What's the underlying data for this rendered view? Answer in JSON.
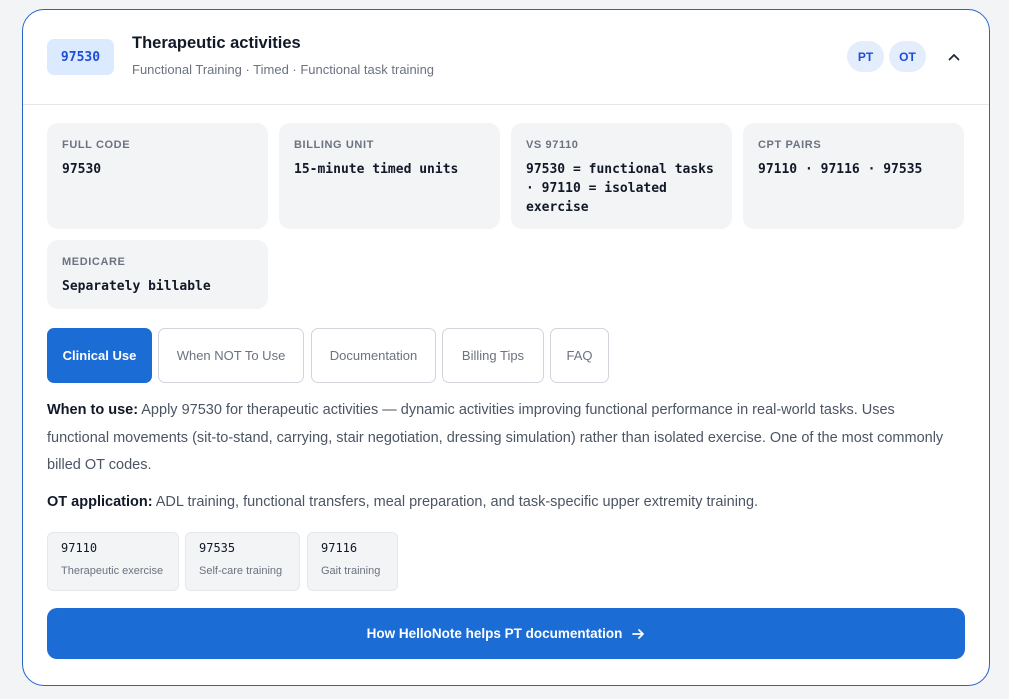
{
  "header": {
    "code": "97530",
    "title": "Therapeutic activities",
    "subtitle": "Functional Training · Timed · Functional task training",
    "disciplines": [
      "PT",
      "OT"
    ]
  },
  "info": [
    {
      "label": "FULL CODE",
      "value": "97530"
    },
    {
      "label": "BILLING UNIT",
      "value": "15-minute timed units"
    },
    {
      "label": "VS 97110",
      "value": "97530 = functional tasks · 97110 = isolated exercise"
    },
    {
      "label": "CPT PAIRS",
      "value": "97110 · 97116 · 97535"
    },
    {
      "label": "MEDICARE",
      "value": "Separately billable"
    }
  ],
  "tabs": [
    {
      "label": "Clinical Use",
      "active": true
    },
    {
      "label": "When NOT To Use",
      "active": false
    },
    {
      "label": "Documentation",
      "active": false
    },
    {
      "label": "Billing Tips",
      "active": false
    },
    {
      "label": "FAQ",
      "active": false
    }
  ],
  "content": {
    "when_label": "When to use:",
    "when_text": "Apply 97530 for therapeutic activities — dynamic activities improving functional performance in real-world tasks. Uses functional movements (sit-to-stand, carrying, stair negotiation, dressing simulation) rather than isolated exercise. One of the most commonly billed OT codes.",
    "ot_label": "OT application:",
    "ot_text": "ADL training, functional transfers, meal preparation, and task-specific upper extremity training."
  },
  "related": [
    {
      "code": "97110",
      "desc": "Therapeutic exercise"
    },
    {
      "code": "97535",
      "desc": "Self-care training"
    },
    {
      "code": "97116",
      "desc": "Gait training"
    }
  ],
  "cta": {
    "label": "How HelloNote helps PT documentation"
  },
  "colors": {
    "accent": "#1c6cd6",
    "border": "#2563c9",
    "pill_bg": "#dbeafe"
  },
  "icons": {
    "collapse": "chevron-up-icon",
    "cta_arrow": "arrow-right-icon"
  }
}
